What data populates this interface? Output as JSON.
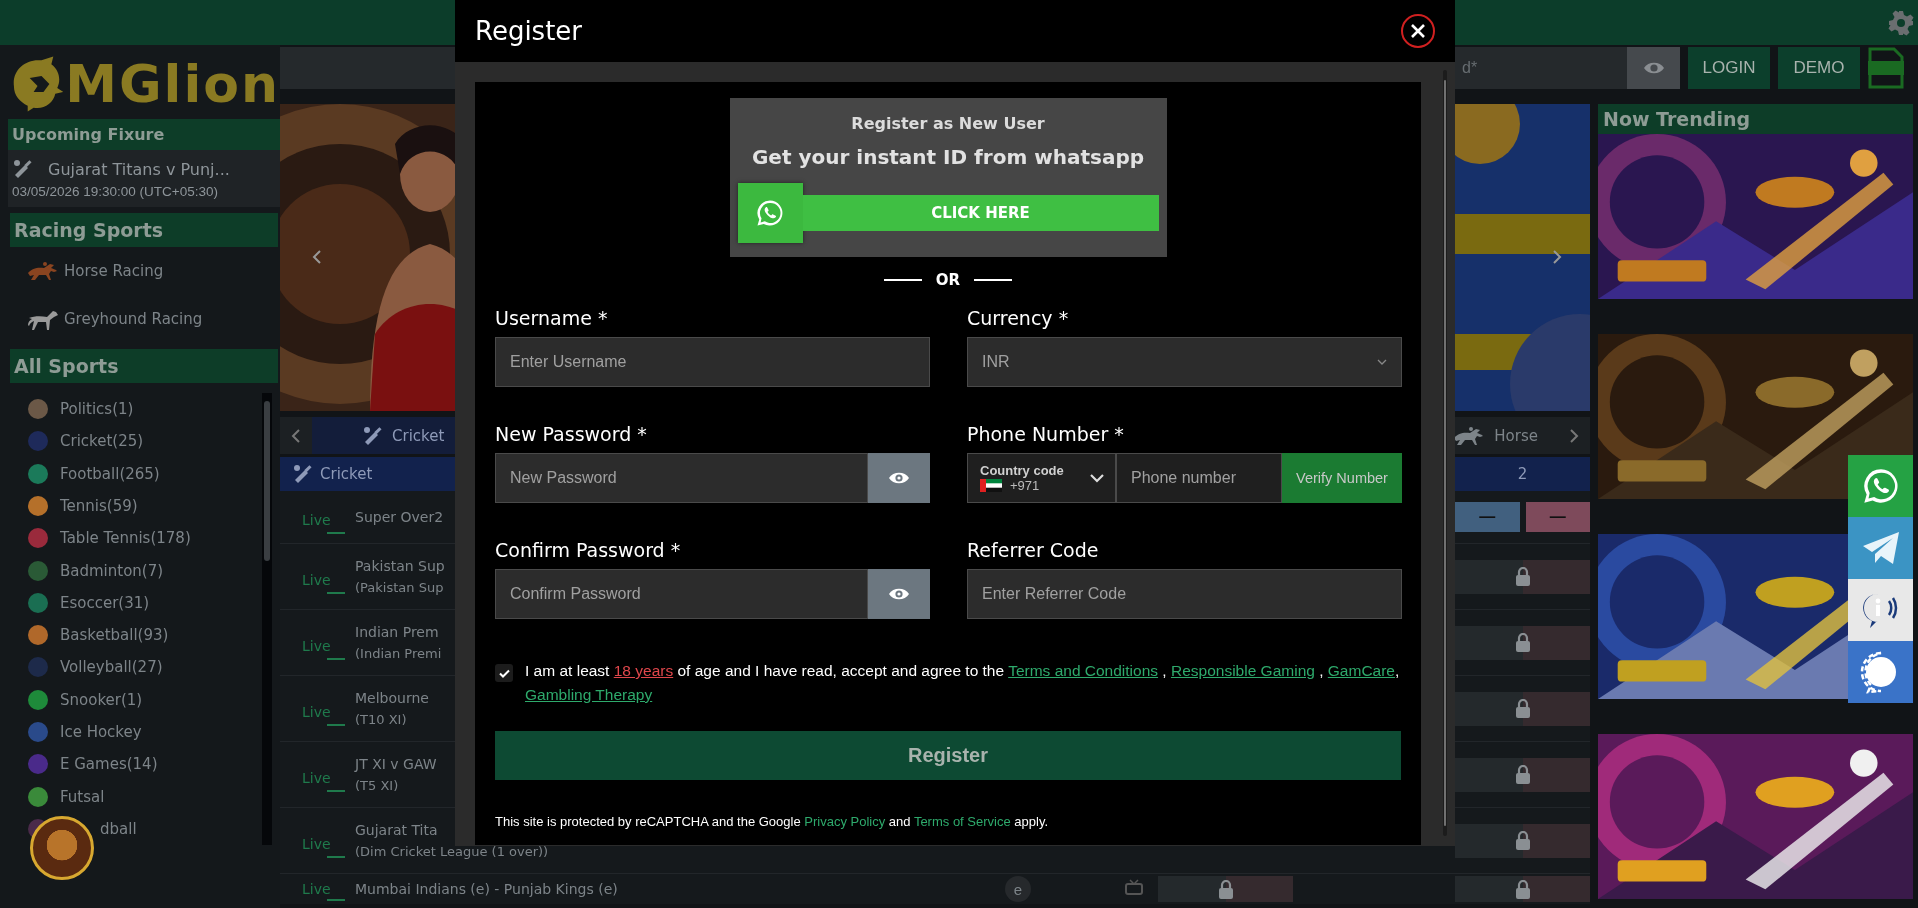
{
  "sidebar": {
    "logo": "MGlion",
    "upcoming": {
      "title": "Upcoming Fixure",
      "match": "Gujarat Titans v Punj...",
      "time": "03/05/2026 19:30:00 (UTC+05:30)"
    },
    "racing": {
      "title": "Racing Sports",
      "items": [
        {
          "label": "Horse Racing",
          "kind": "horse"
        },
        {
          "label": "Greyhound Racing",
          "kind": "dog"
        }
      ]
    },
    "all_sports": {
      "title": "All Sports",
      "items": [
        {
          "label": "Politics(1)",
          "color": "#6b5847"
        },
        {
          "label": "Cricket(25)",
          "color": "#1e2a5a"
        },
        {
          "label": "Football(265)",
          "color": "#1b7a5a"
        },
        {
          "label": "Tennis(59)",
          "color": "#b5702a"
        },
        {
          "label": "Table Tennis(178)",
          "color": "#9a2a3c"
        },
        {
          "label": "Badminton(7)",
          "color": "#2a5a36"
        },
        {
          "label": "Esoccer(31)",
          "color": "#1a6e52"
        },
        {
          "label": "Basketball(93)",
          "color": "#b0682a"
        },
        {
          "label": "Volleyball(27)",
          "color": "#1d2a4a"
        },
        {
          "label": "Snooker(1)",
          "color": "#1e8a3a"
        },
        {
          "label": "Ice Hockey",
          "color": "#2a4a8a"
        },
        {
          "label": "E Games(14)",
          "color": "#4a2a8a"
        },
        {
          "label": "Futsal",
          "color": "#3a8a3a"
        },
        {
          "label": "dball",
          "color": "#4a2a4a"
        }
      ]
    }
  },
  "header": {
    "password_tail": "d*",
    "login": "LOGIN",
    "demo": "DEMO"
  },
  "sport_tabs": [
    {
      "label": "Cricket",
      "kind": "cricket",
      "selected": true
    },
    {
      "label": "Horse",
      "kind": "horse",
      "selected": false
    }
  ],
  "market": {
    "title": "Cricket",
    "column": "2",
    "rows": [
      {
        "kind": "odds",
        "live": "Live",
        "name": "Super Over2",
        "back": "—",
        "lay": "—"
      },
      {
        "kind": "locked",
        "live": "Live",
        "name": "Pakistan Sup",
        "sub": "(Pakistan Sup"
      },
      {
        "kind": "locked",
        "live": "Live",
        "name": "Indian Prem",
        "sub": "(Indian Premi"
      },
      {
        "kind": "locked",
        "live": "Live",
        "name": "Melbourne",
        "sub": "(T10 XI)"
      },
      {
        "kind": "locked",
        "live": "Live",
        "name": "JT XI v GAW",
        "sub": "(T5 XI)"
      },
      {
        "kind": "locked",
        "live": "Live",
        "name": "Gujarat Tita",
        "sub": "(Dim Cricket League (1 over))"
      },
      {
        "kind": "locked",
        "live": "Live",
        "name": "Mumbai Indians (e) - Punjab Kings (e)",
        "badge": "e",
        "tv": true,
        "lock_1": true
      }
    ]
  },
  "trending": {
    "title": "Now Trending"
  },
  "social": [
    {
      "kind": "whatsapp"
    },
    {
      "kind": "telegram"
    },
    {
      "kind": "info"
    },
    {
      "kind": "chat"
    }
  ],
  "modal": {
    "title": "Register",
    "promo": {
      "title": "Register as New User",
      "subtitle": "Get your instant ID from whatsapp",
      "button": "CLICK HERE"
    },
    "divider": "OR",
    "fields": [
      {
        "kind": "text",
        "label": "Username *",
        "placeholder": "Enter Username"
      },
      {
        "kind": "select",
        "label": "Currency *",
        "value": "INR"
      },
      {
        "kind": "password",
        "label": "New Password *",
        "placeholder": "New Password"
      },
      {
        "kind": "phone",
        "label": "Phone Number *",
        "code_label": "Country code",
        "code": "+971",
        "placeholder": "Phone number",
        "button": "Verify Number"
      },
      {
        "kind": "password",
        "label": "Confirm Password *",
        "placeholder": "Confirm Password"
      },
      {
        "kind": "text",
        "label": "Referrer Code",
        "placeholder": "Enter Referrer Code"
      }
    ],
    "consent": {
      "checked": true,
      "parts": [
        {
          "kind": "text",
          "text": "I am at least "
        },
        {
          "kind": "warn",
          "text": "18 years"
        },
        {
          "kind": "text",
          "text": " of age and I have read, accept and agree to the "
        },
        {
          "kind": "link",
          "text": "Terms and Conditions"
        },
        {
          "kind": "text",
          "text": " , "
        },
        {
          "kind": "link",
          "text": "Responsible Gaming"
        },
        {
          "kind": "text",
          "text": " , "
        },
        {
          "kind": "link",
          "text": "GamCare"
        },
        {
          "kind": "text",
          "text": ", "
        },
        {
          "kind": "link",
          "text": "Gambling Therapy"
        }
      ]
    },
    "submit": "Register",
    "recaptcha": [
      {
        "kind": "text",
        "text": "This site is protected by reCAPTCHA and the Google "
      },
      {
        "kind": "link",
        "text": "Privacy Policy"
      },
      {
        "kind": "text",
        "text": " and "
      },
      {
        "kind": "link",
        "text": "Terms of Service"
      },
      {
        "kind": "text",
        "text": " apply."
      }
    ]
  }
}
